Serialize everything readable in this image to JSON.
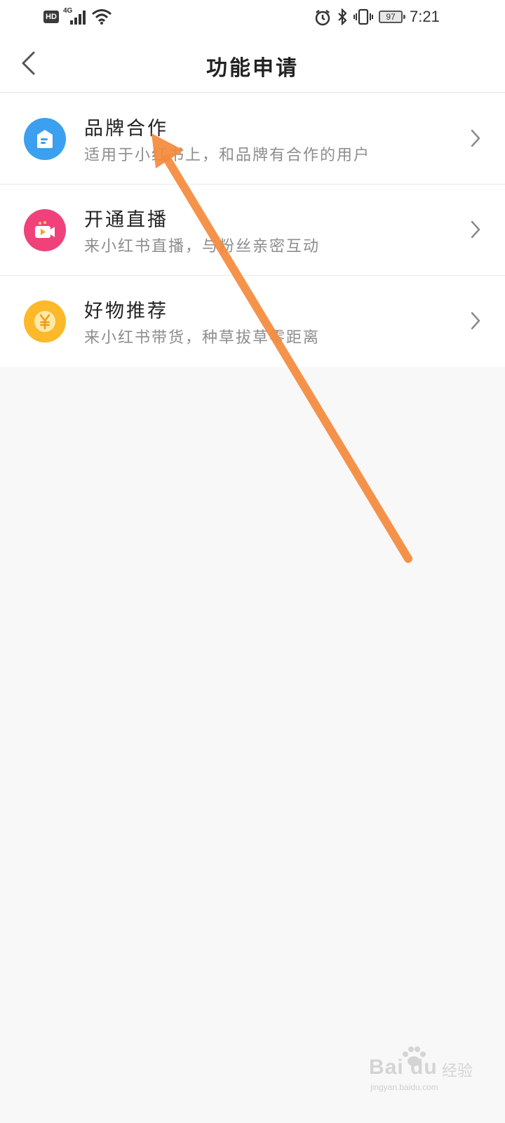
{
  "status_bar": {
    "hd_label": "HD",
    "network_label": "4G",
    "battery_level": "97",
    "time": "7:21"
  },
  "header": {
    "title": "功能申请"
  },
  "features": [
    {
      "title": "品牌合作",
      "description": "适用于小红书上，和品牌有合作的用户",
      "icon": "brand-tag-icon",
      "color": "#3aa0ef"
    },
    {
      "title": "开通直播",
      "description": "来小红书直播，与粉丝亲密互动",
      "icon": "live-video-icon",
      "color": "#f0417a"
    },
    {
      "title": "好物推荐",
      "description": "来小红书带货，种草拔草零距离",
      "icon": "yuan-coin-icon",
      "color": "#fdb92a"
    }
  ],
  "colors": {
    "annotation_arrow": "#f58a3c",
    "background": "#f8f8f8",
    "list_background": "#ffffff"
  },
  "watermark": {
    "brand": "Bai du",
    "label": "经验",
    "domain": "jingyan.baidu.com"
  }
}
